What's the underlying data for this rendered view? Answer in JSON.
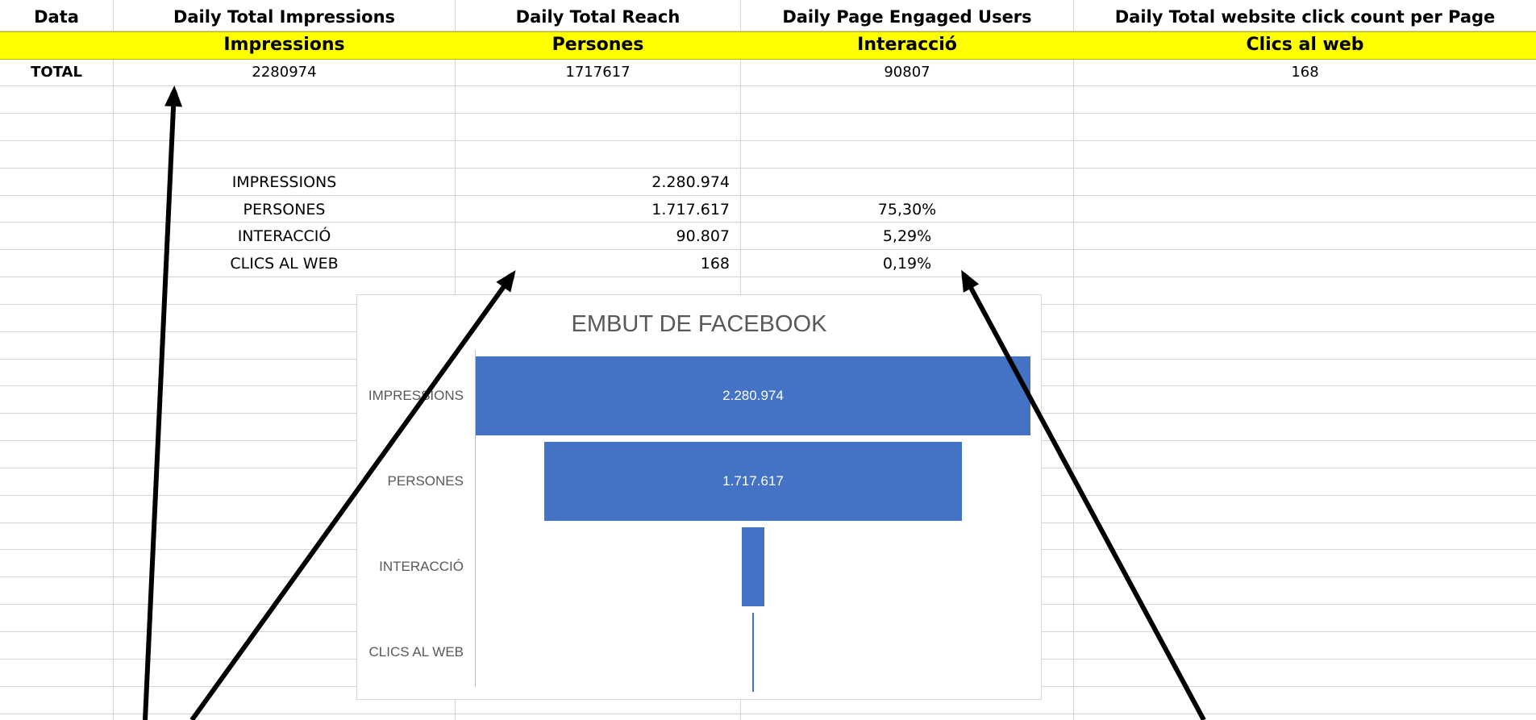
{
  "header": {
    "col_a": "Data",
    "col_b": "Daily Total Impressions",
    "col_c": "Daily Total Reach",
    "col_d": "Daily Page Engaged Users",
    "col_e": "Daily Total website click count per Page"
  },
  "subheader": {
    "col_b": "Impressions",
    "col_c": "Persones",
    "col_d": "Interacció",
    "col_e": "Clics al web"
  },
  "total_row": {
    "label": "TOTAL",
    "impressions": "2280974",
    "reach": "1717617",
    "engaged": "90807",
    "clicks": "168"
  },
  "summary": [
    {
      "label": "IMPRESSIONS",
      "value": "2.280.974",
      "pct": ""
    },
    {
      "label": "PERSONES",
      "value": "1.717.617",
      "pct": "75,30%"
    },
    {
      "label": "INTERACCIÓ",
      "value": "90.807",
      "pct": "5,29%"
    },
    {
      "label": "CLICS AL WEB",
      "value": "168",
      "pct": "0,19%"
    }
  ],
  "chart_data": {
    "type": "bar",
    "title": "EMBUT DE FACEBOOK",
    "categories": [
      "IMPRESSIONS",
      "PERSONES",
      "INTERACCIÓ",
      "CLICS AL WEB"
    ],
    "values": [
      2280974,
      1717617,
      90807,
      168
    ],
    "data_labels": [
      "2.280.974",
      "1.717.617",
      "",
      ""
    ],
    "bar_color": "#4472c4",
    "orientation": "horizontal-funnel"
  },
  "colors": {
    "header_band": "#ffff00",
    "gridline": "#d4d4d4"
  }
}
